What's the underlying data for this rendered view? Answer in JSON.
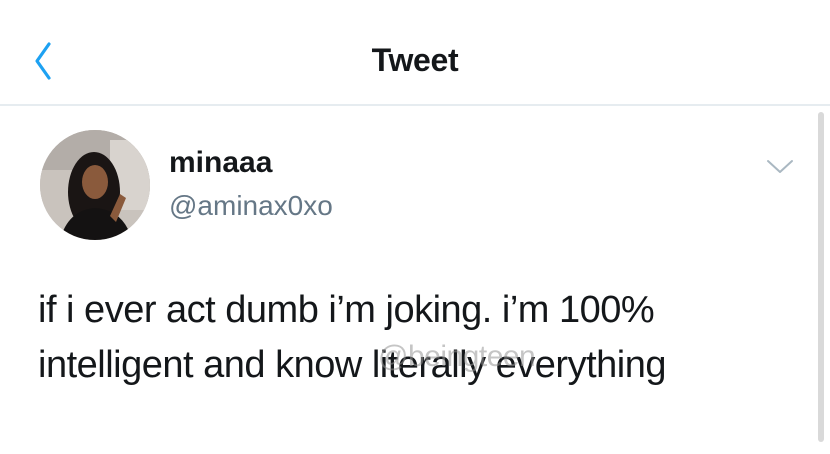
{
  "nav": {
    "back_icon": "chevron-left-icon",
    "title": "Tweet"
  },
  "tweet": {
    "author": {
      "display_name": "minaaa",
      "handle": "@aminax0xo",
      "avatar_icon": "profile-photo"
    },
    "more_icon": "chevron-down-icon",
    "text_lines": [
      "if i ever act dumb i’m joking. i’m 100%",
      "intelligent and know literally everything"
    ],
    "watermark": "@beingteen"
  },
  "colors": {
    "accent": "#1da1f2",
    "text_primary": "#14171a",
    "text_secondary": "#657786",
    "divider": "#e6ecf0"
  }
}
